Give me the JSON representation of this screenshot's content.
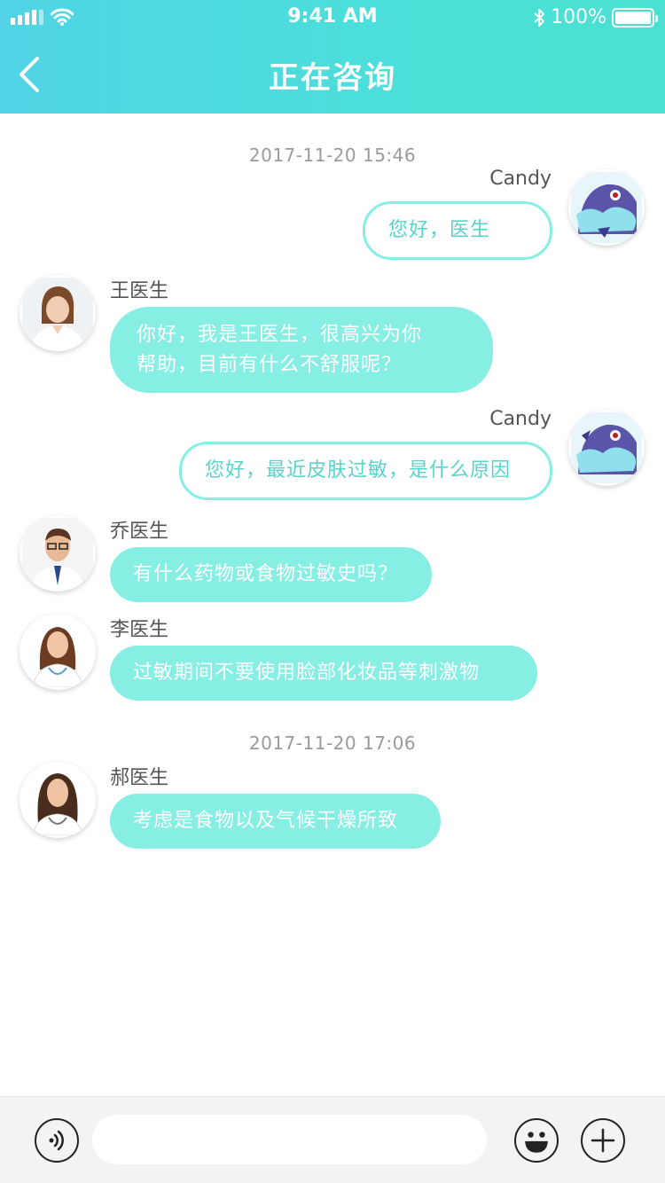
{
  "status_bar": {
    "time": "9:41 AM",
    "battery": "100%",
    "battery_level": 1.0,
    "signal_bars": 5
  },
  "nav": {
    "title": "正在咨询"
  },
  "chat": {
    "timestamps": [
      "2017-11-20  15:46",
      "2017-11-20  17:06"
    ],
    "messages": [
      {
        "direction": "out",
        "sender": "Candy",
        "text": "您好，医生"
      },
      {
        "direction": "in",
        "sender": "王医生",
        "text_line1": "你好，我是王医生，很高兴为你",
        "text_line2": "帮助，目前有什么不舒服呢？"
      },
      {
        "direction": "out",
        "sender": "Candy",
        "text": "您好，最近皮肤过敏，是什么原因"
      },
      {
        "direction": "in",
        "sender": "乔医生",
        "text": "有什么药物或食物过敏史吗？"
      },
      {
        "direction": "in",
        "sender": "李医生",
        "text": "过敏期间不要使用脸部化妆品等刺激物"
      },
      {
        "direction": "in",
        "sender": "郝医生",
        "text": "考虑是食物以及气候干燥所致"
      }
    ]
  },
  "input_bar": {
    "placeholder": ""
  },
  "colors": {
    "accent": "#4bdfd9",
    "bubble": "#87eee4",
    "outgoing_text": "#58d3cb"
  },
  "icons": [
    "back-icon",
    "voice-icon",
    "emoji-icon",
    "plus-icon",
    "bluetooth-icon",
    "wifi-icon",
    "signal-icon",
    "battery-icon"
  ]
}
